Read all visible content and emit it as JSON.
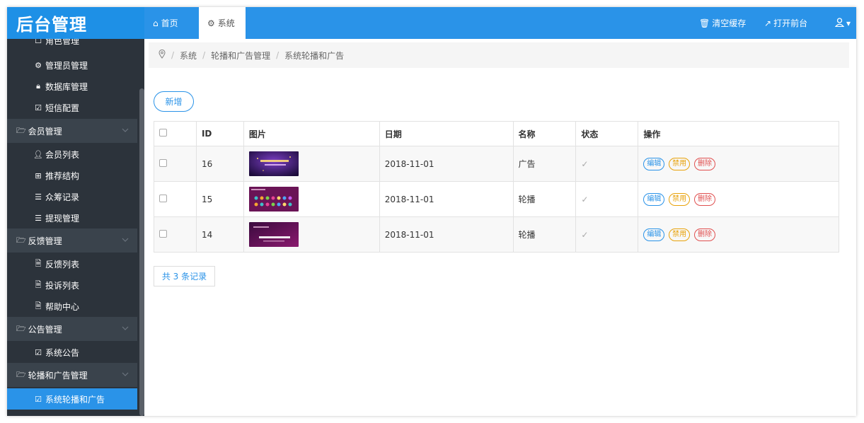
{
  "app": {
    "title": "后台管理"
  },
  "topbar": {
    "tabs": [
      {
        "label": "首页",
        "icon": "home-icon"
      },
      {
        "label": "系统",
        "icon": "gear-icon"
      }
    ],
    "actions": [
      {
        "label": "清空缓存",
        "icon": "trash-icon"
      },
      {
        "label": "打开前台",
        "icon": "external-link-icon"
      }
    ],
    "user_icon": "user-icon"
  },
  "sidebar": {
    "partial_top": "角色管理",
    "items_system": [
      {
        "label": "管理员管理",
        "icon": "gear-icon"
      },
      {
        "label": "数据库管理",
        "icon": "lock-icon"
      },
      {
        "label": "短信配置",
        "icon": "check-square-icon"
      }
    ],
    "group_member": {
      "label": "会员管理",
      "icon": "folder-icon"
    },
    "items_member": [
      {
        "label": "会员列表",
        "icon": "user-icon"
      },
      {
        "label": "推荐结构",
        "icon": "grid-icon"
      },
      {
        "label": "众筹记录",
        "icon": "list-icon"
      },
      {
        "label": "提现管理",
        "icon": "list-icon"
      }
    ],
    "group_feedback": {
      "label": "反馈管理",
      "icon": "folder-icon"
    },
    "items_feedback": [
      {
        "label": "反馈列表",
        "icon": "document-icon"
      },
      {
        "label": "投诉列表",
        "icon": "document-icon"
      },
      {
        "label": "帮助中心",
        "icon": "document-icon"
      }
    ],
    "group_notice": {
      "label": "公告管理",
      "icon": "folder-icon"
    },
    "items_notice": [
      {
        "label": "系统公告",
        "icon": "check-square-icon"
      }
    ],
    "group_banner": {
      "label": "轮播和广告管理",
      "icon": "folder-icon"
    },
    "items_banner": [
      {
        "label": "系统轮播和广告",
        "icon": "check-square-icon"
      }
    ]
  },
  "breadcrumb": {
    "icon": "location-pin-icon",
    "items": [
      "系统",
      "轮播和广告管理",
      "系统轮播和广告"
    ]
  },
  "main": {
    "add_label": "新增",
    "columns": [
      "ID",
      "图片",
      "日期",
      "名称",
      "状态",
      "操作"
    ],
    "rows": [
      {
        "id": "16",
        "date": "2018-11-01",
        "name": "广告"
      },
      {
        "id": "15",
        "date": "2018-11-01",
        "name": "轮播"
      },
      {
        "id": "14",
        "date": "2018-11-01",
        "name": "轮播"
      }
    ],
    "actions": {
      "edit": "编辑",
      "ban": "禁用",
      "delete": "删除"
    },
    "total_label": "共 3 条记录"
  },
  "colors": {
    "primary": "#2a93e8",
    "sidebar": "#2c333b",
    "sidebar_group": "#3a434c",
    "warn": "#e8a20a",
    "danger": "#e05050"
  }
}
